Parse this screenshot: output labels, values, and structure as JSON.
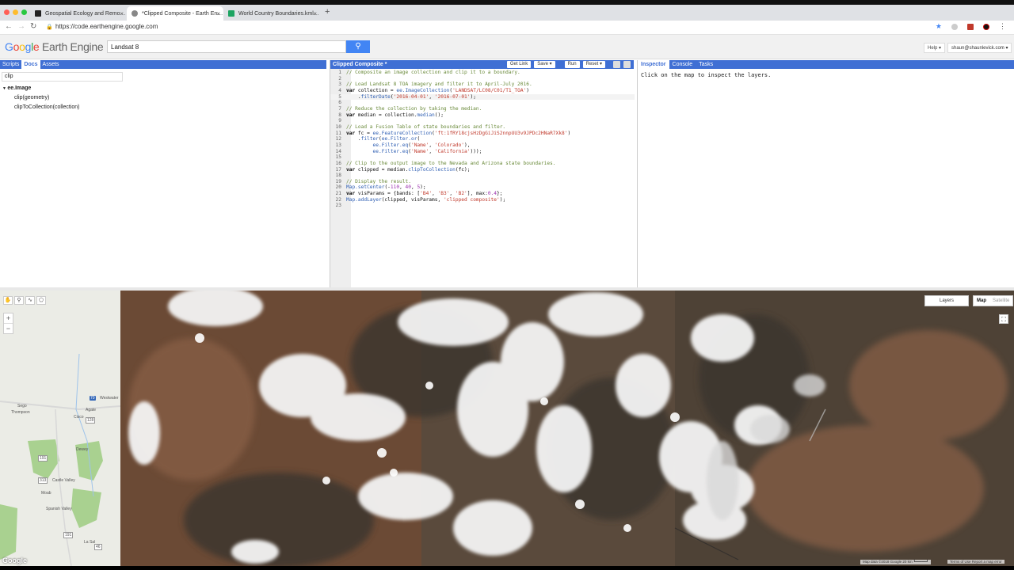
{
  "browser": {
    "tabs": [
      {
        "label": "Geospatial Ecology and Remo…"
      },
      {
        "label": "*Clipped Composite - Earth En…"
      },
      {
        "label": "World Country Boundaries.kml…"
      }
    ],
    "url": "https://code.earthengine.google.com"
  },
  "header": {
    "logo_google": "Google",
    "logo_product": "Earth Engine",
    "search_value": "Landsat 8",
    "help_label": "Help",
    "user_label": "shaun@shaunlevick.com"
  },
  "left_panel": {
    "tabs": [
      "Scripts",
      "Docs",
      "Assets"
    ],
    "filter_value": "clip",
    "tree_header": "ee.Image",
    "tree_items": [
      "clip(geometry)",
      "clipToCollection(collection)"
    ]
  },
  "editor": {
    "title": "Clipped Composite *",
    "buttons": {
      "get_link": "Get Link",
      "save": "Save",
      "run": "Run",
      "reset": "Reset"
    }
  },
  "right_panel": {
    "tabs": [
      "Inspector",
      "Console",
      "Tasks"
    ],
    "message": "Click on the map to inspect the layers."
  },
  "map": {
    "layers_label": "Layers",
    "map_label": "Map",
    "satellite_label": "Satellite",
    "google_mark": "Google",
    "attribution": "Map data ©2018 Google   20 km ┗━━━━━┛",
    "terms": "Terms of Use   Report a map error",
    "places": [
      "Sego",
      "Thompson",
      "Cisco",
      "Agate",
      "Westwater",
      "Dewey",
      "Castle Valley",
      "Moab",
      "Spanish Valley",
      "La Sal"
    ],
    "shields": [
      "70",
      "191",
      "128",
      "313",
      "191",
      "46"
    ]
  },
  "colors": {
    "accent": "#3f6fd4",
    "search_button": "#4285f4"
  }
}
